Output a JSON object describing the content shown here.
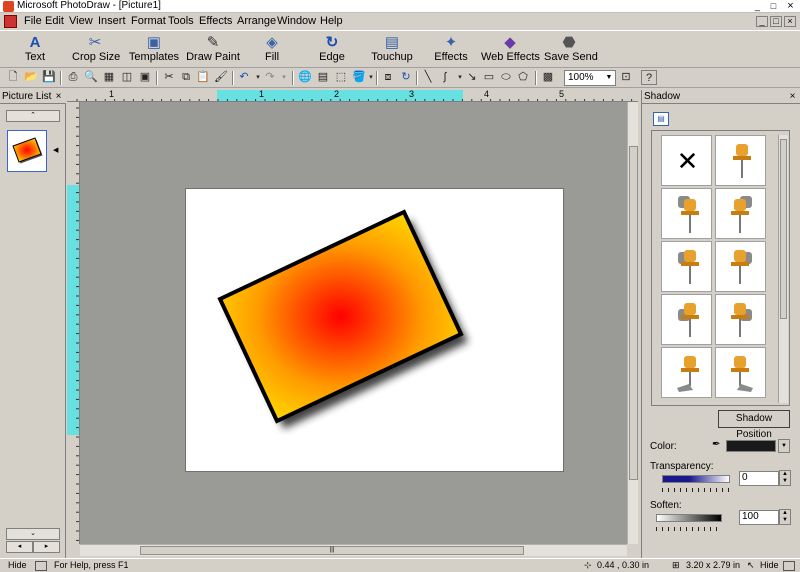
{
  "window": {
    "title": "Microsoft PhotoDraw - [Picture1]",
    "minimize": "_",
    "maximize": "□",
    "close": "×"
  },
  "menu": [
    "File",
    "Edit",
    "View",
    "Insert",
    "Format",
    "Tools",
    "Effects",
    "Arrange",
    "Window",
    "Help"
  ],
  "visual_menu": [
    {
      "label": "Text",
      "icon": "A"
    },
    {
      "label": "Crop Size",
      "icon": "✂"
    },
    {
      "label": "Templates",
      "icon": "▣"
    },
    {
      "label": "Draw Paint",
      "icon": "✎"
    },
    {
      "label": "Fill",
      "icon": "◈"
    },
    {
      "label": "Edge",
      "icon": "↻"
    },
    {
      "label": "Touchup",
      "icon": "▤"
    },
    {
      "label": "Effects",
      "icon": "✦"
    },
    {
      "label": "Web Effects",
      "icon": "◆"
    },
    {
      "label": "Save Send",
      "icon": "⬣"
    }
  ],
  "toolbar": {
    "zoom_value": "100%"
  },
  "picture_list": {
    "title": "Picture List",
    "close": "×",
    "scroll_up": "⌃",
    "scroll_down": "⌄"
  },
  "shadow_panel": {
    "title": "Shadow",
    "close": "×",
    "none_symbol": "✕",
    "position_button": "Shadow Position",
    "color_label": "Color:",
    "transparency_label": "Transparency:",
    "transparency_value": "0",
    "soften_label": "Soften:",
    "soften_value": "100"
  },
  "status": {
    "hide_left": "Hide",
    "help_text": "For Help, press F1",
    "position": "0.44 , 0.30 in",
    "size": "3.20 x 2.79 in",
    "hide_right": "Hide"
  },
  "ruler_labels": [
    "1",
    "1",
    "2",
    "3",
    "4",
    "5"
  ],
  "colors": {
    "gradient_center": "#ff0000",
    "gradient_edge": "#ffe800",
    "shadow_color": "#1a1a1a",
    "ruler_highlight": "#66e0e0",
    "pin_color": "#e7a12c",
    "pin_gray": "#8a8a8a"
  }
}
